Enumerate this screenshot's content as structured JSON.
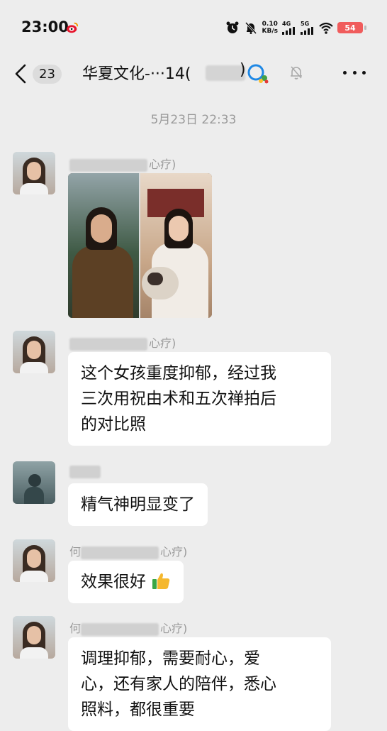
{
  "status_bar": {
    "time": "23:00",
    "speed_value": "0.10",
    "speed_unit": "KB/s",
    "net1": "4G",
    "net2": "5G",
    "battery": "54",
    "battery_color": "#f05c5c"
  },
  "header": {
    "unread_count": "23",
    "title": "华夏文化-···14(",
    "title_end": ")"
  },
  "chat": {
    "timestamp": "5月23日 22:33",
    "messages": [
      {
        "sender_suffix": "心疗)",
        "type": "image"
      },
      {
        "sender_suffix": "心疗)",
        "type": "text",
        "lines": [
          "这个女孩重度抑郁，经过我",
          "三次用祝由术和五次禅拍后",
          "的对比照"
        ]
      },
      {
        "sender_suffix": "",
        "type": "text",
        "lines": [
          "精气神明显变了"
        ]
      },
      {
        "sender_prefix": "何",
        "sender_suffix": "心疗)",
        "type": "text",
        "lines": [
          "效果很好"
        ]
      },
      {
        "sender_prefix": "何",
        "sender_suffix": "心疗)",
        "type": "text",
        "lines": [
          "调理抑郁，需要耐心，爱",
          "心，还有家人的陪伴，悉心",
          "照料，都很重要"
        ]
      }
    ]
  },
  "colors": {
    "background": "#ededed",
    "bubble": "#ffffff",
    "muted_text": "#9a9a9a"
  }
}
